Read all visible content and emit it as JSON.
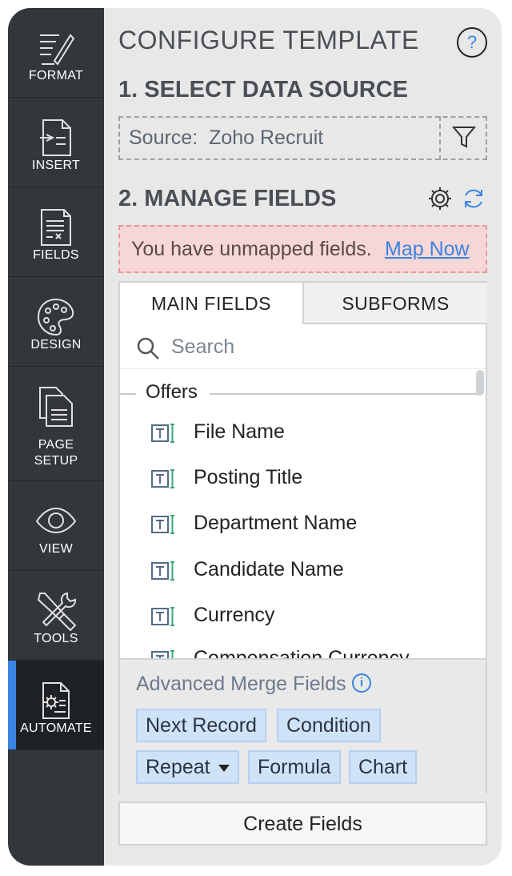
{
  "rail": {
    "items": [
      {
        "label": "FORMAT",
        "icon": "format-icon"
      },
      {
        "label": "INSERT",
        "icon": "insert-icon"
      },
      {
        "label": "FIELDS",
        "icon": "fields-icon"
      },
      {
        "label": "DESIGN",
        "icon": "palette-icon"
      },
      {
        "label": "PAGE SETUP",
        "icon": "page-setup-icon"
      },
      {
        "label": "VIEW",
        "icon": "eye-icon"
      },
      {
        "label": "TOOLS",
        "icon": "tools-icon"
      },
      {
        "label": "AUTOMATE",
        "icon": "automate-icon"
      }
    ],
    "active": "AUTOMATE",
    "active_color": "#3a84e3"
  },
  "panel": {
    "title": "CONFIGURE TEMPLATE",
    "help": "?",
    "section1": "1. SELECT DATA SOURCE",
    "source_label": "Source:",
    "source_value": "Zoho Recruit",
    "section2": "2. MANAGE FIELDS",
    "warning": "You have unmapped fields.",
    "warning_link": "Map Now",
    "tabs": [
      "MAIN FIELDS",
      "SUBFORMS"
    ],
    "search_placeholder": "Search",
    "group": "Offers",
    "fields": [
      "File Name",
      "Posting Title",
      "Department Name",
      "Candidate Name",
      "Currency",
      "Compensation Currency"
    ],
    "advanced_title": "Advanced Merge Fields",
    "chips": [
      "Next Record",
      "Condition",
      "Repeat",
      "Formula",
      "Chart"
    ],
    "create_button": "Create Fields"
  },
  "colors": {
    "rail_bg": "#33373b",
    "accent": "#3a84e3",
    "warning_bg": "#f7d6d6",
    "chip_bg": "#cfe3f8"
  }
}
